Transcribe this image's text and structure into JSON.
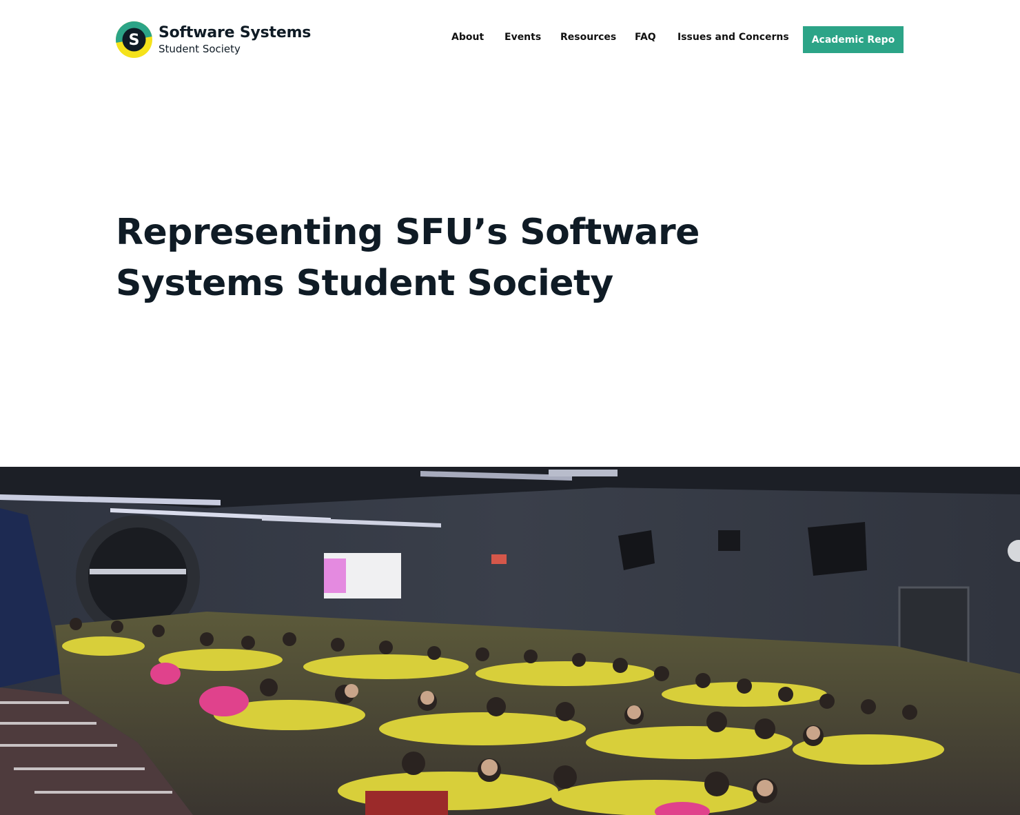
{
  "brand": {
    "title": "Software Systems",
    "subtitle": "Student Society",
    "logo_letter": "S",
    "colors": {
      "teal": "#2ca487",
      "yellow": "#f5e21b",
      "dark": "#0f1b25"
    }
  },
  "nav": {
    "items": [
      {
        "label": "About"
      },
      {
        "label": "Events"
      },
      {
        "label": "Resources"
      },
      {
        "label": "FAQ"
      },
      {
        "label": "Issues and Concerns"
      }
    ],
    "cta_label": "Academic Repo",
    "cta_color": "#2ca487"
  },
  "hero": {
    "title_line1": "Representing SFU’s Software",
    "title_line2": "Systems Student Society",
    "photo_icon": "audience-photo"
  }
}
